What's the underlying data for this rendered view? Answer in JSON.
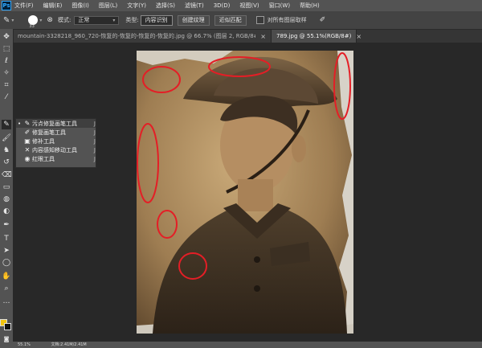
{
  "menubar": {
    "logo": "Ps",
    "items": [
      "文件(F)",
      "编辑(E)",
      "图像(I)",
      "图层(L)",
      "文字(Y)",
      "选择(S)",
      "滤镜(T)",
      "3D(D)",
      "视图(V)",
      "窗口(W)",
      "帮助(H)"
    ]
  },
  "options": {
    "brush_size": "33",
    "mode_label": "模式:",
    "mode_value": "正常",
    "type_label": "类型:",
    "type_buttons": [
      "内容识别",
      "创建纹理",
      "近似匹配"
    ],
    "sample_all_label": "对所有图层取样"
  },
  "tabs": [
    {
      "label": "mountain-3328218_960_720-恢复的-恢复的-恢复的-恢复的.jpg @ 66.7% (图层 2, RGB/8#)",
      "active": false
    },
    {
      "label": "789.jpg @ 55.1%(RGB/8#)",
      "active": true
    }
  ],
  "flyout": {
    "items": [
      {
        "label": "污点修复画笔工具",
        "key": "J",
        "active": true
      },
      {
        "label": "修复画笔工具",
        "key": "J",
        "active": false
      },
      {
        "label": "修补工具",
        "key": "J",
        "active": false
      },
      {
        "label": "内容感知移动工具",
        "key": "J",
        "active": false
      },
      {
        "label": "红眼工具",
        "key": "J",
        "active": false
      }
    ]
  },
  "tools": [
    "move-icon",
    "marquee-icon",
    "lasso-icon",
    "quick-select-icon",
    "crop-icon",
    "eyedropper-icon",
    "healing-brush-icon",
    "brush-icon",
    "stamp-icon",
    "history-brush-icon",
    "eraser-icon",
    "gradient-icon",
    "blur-icon",
    "dodge-icon",
    "pen-icon",
    "type-icon",
    "path-select-icon",
    "shape-icon",
    "hand-icon",
    "zoom-icon",
    "more-icon"
  ],
  "colors": {
    "foreground": "#f1c40f",
    "background": "#111111",
    "annotation": "#e41e26"
  },
  "status": {
    "zoom": "55.1%",
    "doc": "文档:2.41M/2.41M"
  }
}
